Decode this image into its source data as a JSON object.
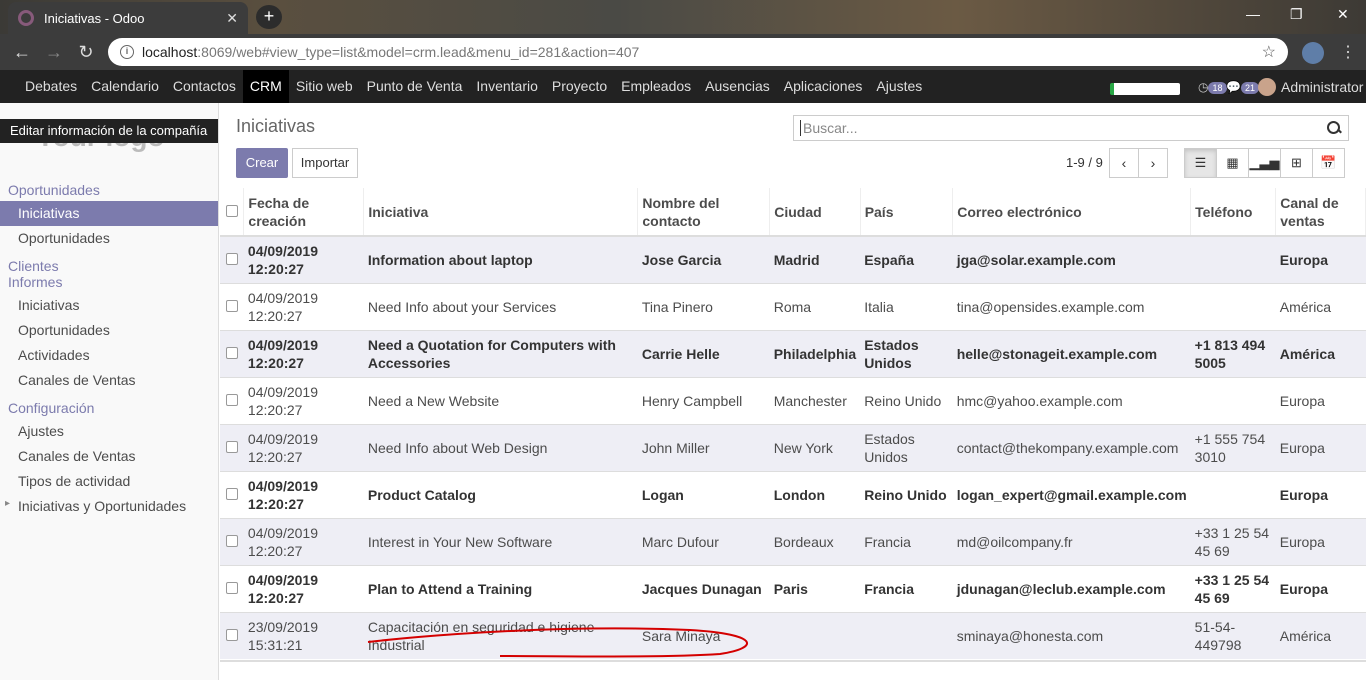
{
  "browser": {
    "tab_title": "Iniciativas - Odoo",
    "url_host": "localhost",
    "url_rest": ":8069/web#view_type=list&model=crm.lead&menu_id=281&action=407"
  },
  "topmenu": {
    "items": [
      "Debates",
      "Calendario",
      "Contactos",
      "CRM",
      "Sitio web",
      "Punto de Venta",
      "Inventario",
      "Proyecto",
      "Empleados",
      "Ausencias",
      "Aplicaciones",
      "Ajustes"
    ],
    "active": "CRM",
    "activity_badge": "18",
    "message_badge": "21",
    "user": "Administrator"
  },
  "sidebar": {
    "edit_company": "Editar información de la compañía",
    "logo_text": "Your logo",
    "sections": [
      {
        "title": "Oportunidades",
        "items": [
          "Iniciativas",
          "Oportunidades"
        ]
      },
      {
        "title": "Clientes",
        "items": []
      },
      {
        "title": "Informes",
        "items": [
          "Iniciativas",
          "Oportunidades",
          "Actividades",
          "Canales de Ventas"
        ]
      },
      {
        "title": "Configuración",
        "items": [
          "Ajustes",
          "Canales de Ventas",
          "Tipos de actividad",
          "Iniciativas y Oportunidades"
        ]
      }
    ]
  },
  "control": {
    "title": "Iniciativas",
    "search_placeholder": "Buscar...",
    "create": "Crear",
    "import": "Importar",
    "pager": "1-9 / 9"
  },
  "table": {
    "headers": [
      "Fecha de creación",
      "Iniciativa",
      "Nombre del contacto",
      "Ciudad",
      "País",
      "Correo electrónico",
      "Teléfono",
      "Canal de ventas"
    ],
    "rows": [
      {
        "bold": true,
        "cells": [
          "04/09/2019 12:20:27",
          "Information about laptop",
          "Jose Garcia",
          "Madrid",
          "España",
          "jga@solar.example.com",
          "",
          "Europa"
        ]
      },
      {
        "bold": false,
        "cells": [
          "04/09/2019 12:20:27",
          "Need Info about your Services",
          "Tina Pinero",
          "Roma",
          "Italia",
          "tina@opensides.example.com",
          "",
          "América"
        ]
      },
      {
        "bold": true,
        "cells": [
          "04/09/2019 12:20:27",
          "Need a Quotation for Computers with Accessories",
          "Carrie Helle",
          "Philadelphia",
          "Estados Unidos",
          "helle@stonageit.example.com",
          "+1 813 494 5005",
          "América"
        ]
      },
      {
        "bold": false,
        "cells": [
          "04/09/2019 12:20:27",
          "Need a New Website",
          "Henry Campbell",
          "Manchester",
          "Reino Unido",
          "hmc@yahoo.example.com",
          "",
          "Europa"
        ]
      },
      {
        "bold": false,
        "cells": [
          "04/09/2019 12:20:27",
          "Need Info about Web Design",
          "John Miller",
          "New York",
          "Estados Unidos",
          "contact@thekompany.example.com",
          "+1 555 754 3010",
          "Europa"
        ]
      },
      {
        "bold": true,
        "cells": [
          "04/09/2019 12:20:27",
          "Product Catalog",
          "Logan",
          "London",
          "Reino Unido",
          "logan_expert@gmail.example.com",
          "",
          "Europa"
        ]
      },
      {
        "bold": false,
        "cells": [
          "04/09/2019 12:20:27",
          "Interest in Your New Software",
          "Marc Dufour",
          "Bordeaux",
          "Francia",
          "md@oilcompany.fr",
          "+33 1 25 54 45 69",
          "Europa"
        ]
      },
      {
        "bold": true,
        "cells": [
          "04/09/2019 12:20:27",
          "Plan to Attend a Training",
          "Jacques Dunagan",
          "Paris",
          "Francia",
          "jdunagan@leclub.example.com",
          "+33 1 25 54 45 69",
          "Europa"
        ]
      },
      {
        "bold": false,
        "cells": [
          "23/09/2019 15:31:21",
          "Capacitación en seguridad e higiene Industrial",
          "Sara Minaya",
          "",
          "",
          "sminaya@honesta.com",
          "51-54-449798",
          "América"
        ]
      }
    ]
  },
  "colors": {
    "brand": "#7c7bad",
    "menu_bg": "#222222",
    "annotation": "#d40000"
  }
}
